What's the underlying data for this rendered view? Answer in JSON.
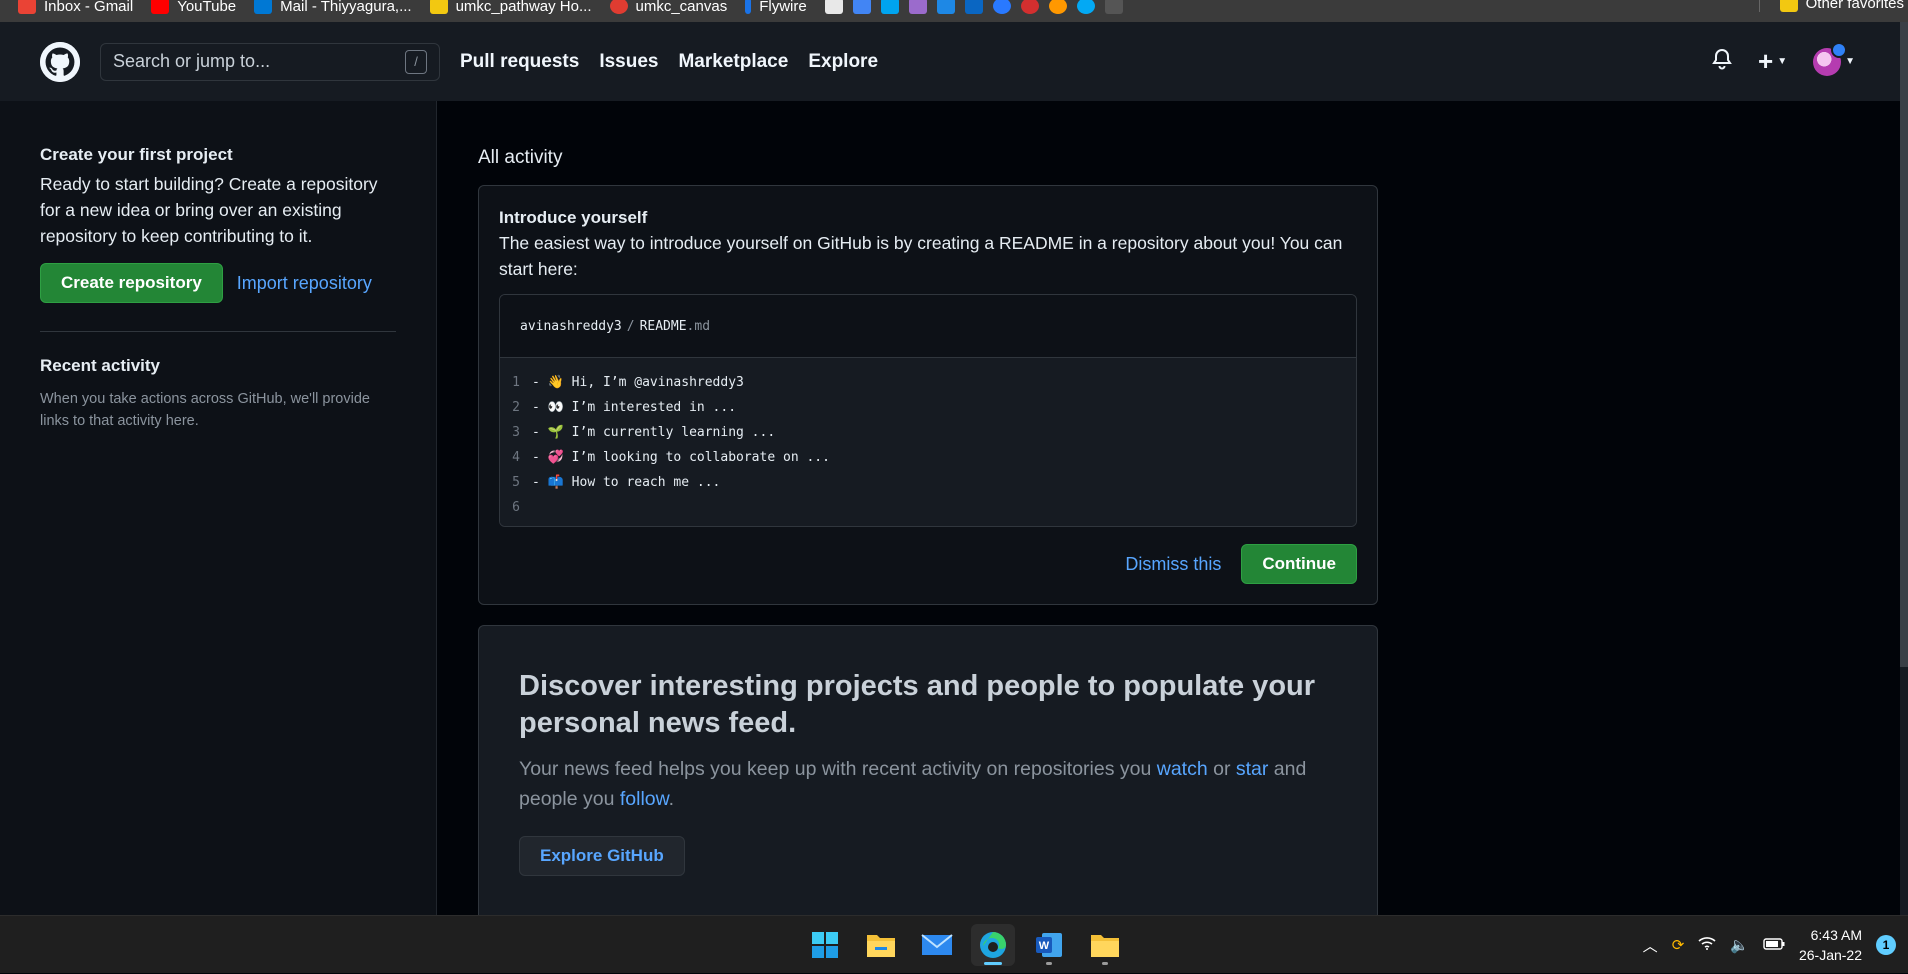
{
  "bookmarks": {
    "items": [
      {
        "label": "Inbox - Gmail",
        "color": "#ea4335"
      },
      {
        "label": "YouTube",
        "color": "#ff0000"
      },
      {
        "label": "Mail - Thiyyagura,...",
        "color": "#0078d4"
      },
      {
        "label": "umkc_pathway Ho...",
        "color": "#f2c811"
      },
      {
        "label": "umkc_canvas",
        "color": "#e03c31"
      },
      {
        "label": "Flywire",
        "color": "#1a73e8"
      }
    ],
    "other_favorites": "Other favorites"
  },
  "header": {
    "search_placeholder": "Search or jump to...",
    "search_shortcut": "/",
    "nav": [
      "Pull requests",
      "Issues",
      "Marketplace",
      "Explore"
    ],
    "plus": "+"
  },
  "sidebar": {
    "create_title": "Create your first project",
    "create_text": "Ready to start building? Create a repository for a new idea or bring over an existing repository to keep contributing to it.",
    "create_button": "Create repository",
    "import_link": "Import repository",
    "recent_title": "Recent activity",
    "recent_text": "When you take actions across GitHub, we'll provide links to that activity here."
  },
  "main": {
    "heading": "All activity",
    "intro": {
      "title": "Introduce yourself",
      "text": "The easiest way to introduce yourself on GitHub is by creating a README in a repository about you! You can start here:",
      "readme_owner": "avinashreddy3",
      "readme_sep": "/",
      "readme_name": "README",
      "readme_ext": ".md",
      "lines": [
        {
          "n": "1",
          "text": "- 👋 Hi, I’m @avinashreddy3"
        },
        {
          "n": "2",
          "text": "- 👀 I’m interested in ..."
        },
        {
          "n": "3",
          "text": "- 🌱 I’m currently learning ..."
        },
        {
          "n": "4",
          "text": "- 💞️ I’m looking to collaborate on ..."
        },
        {
          "n": "5",
          "text": "- 📫 How to reach me ..."
        },
        {
          "n": "6",
          "text": ""
        }
      ],
      "dismiss": "Dismiss this",
      "continue": "Continue"
    },
    "discover": {
      "title": "Discover interesting projects and people to populate your personal news feed.",
      "text_1": "Your news feed helps you keep up with recent activity on repositories you ",
      "watch": "watch",
      "text_2": " or ",
      "star": "star",
      "text_3": " and people you ",
      "follow": "follow",
      "text_4": ".",
      "button": "Explore GitHub"
    }
  },
  "taskbar": {
    "time": "6:43 AM",
    "date": "26-Jan-22",
    "notifications": "1"
  }
}
